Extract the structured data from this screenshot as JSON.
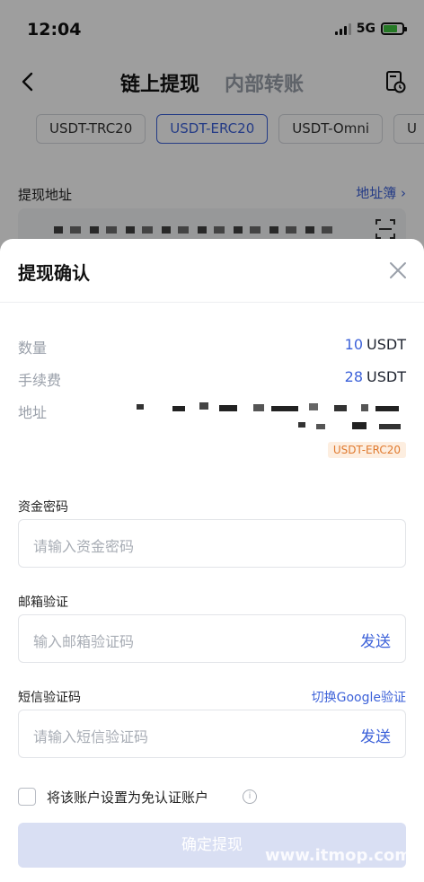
{
  "status_bar": {
    "time": "12:04",
    "network": "5G"
  },
  "nav": {
    "title": "链上提现",
    "tab_internal": "内部转账"
  },
  "chains": [
    "USDT-TRC20",
    "USDT-ERC20",
    "USDT-Omni",
    "U"
  ],
  "address_section": {
    "label": "提现地址",
    "address_book": "地址簿"
  },
  "sheet": {
    "title": "提现确认",
    "quantity_label": "数量",
    "quantity_value": "10",
    "quantity_unit": "USDT",
    "fee_label": "手续费",
    "fee_value": "28",
    "fee_unit": "USDT",
    "address_label": "地址",
    "network_tag": "USDT-ERC20",
    "fund_password": {
      "label": "资金密码",
      "placeholder": "请输入资金密码"
    },
    "email_verify": {
      "label": "邮箱验证",
      "placeholder": "输入邮箱验证码",
      "send": "发送"
    },
    "sms_verify": {
      "label": "短信验证码",
      "switch": "切换Google验证",
      "placeholder": "请输入短信验证码",
      "send": "发送"
    },
    "exempt_checkbox": "将该账户设置为免认证账户",
    "info_glyph": "i",
    "confirm_button": "确定提现"
  },
  "watermark": "www.itmop.com",
  "colors": {
    "accent": "#3d62d9",
    "tag_text": "#e07a2f",
    "tag_bg": "#fdeee0"
  }
}
